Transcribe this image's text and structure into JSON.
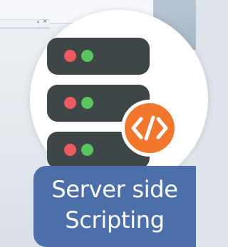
{
  "title": {
    "line1": "Server side",
    "line2": "Scripting"
  },
  "background": {
    "window_glyphs": "ᵩ ×"
  },
  "icons": {
    "main": "server-stack-icon",
    "badge": "code-brackets-icon"
  },
  "colors": {
    "server": "#3f4647",
    "led_red": "#ec5b5f",
    "led_green": "#58c65c",
    "badge": "#f0772b",
    "label": "#4d6fa9"
  }
}
